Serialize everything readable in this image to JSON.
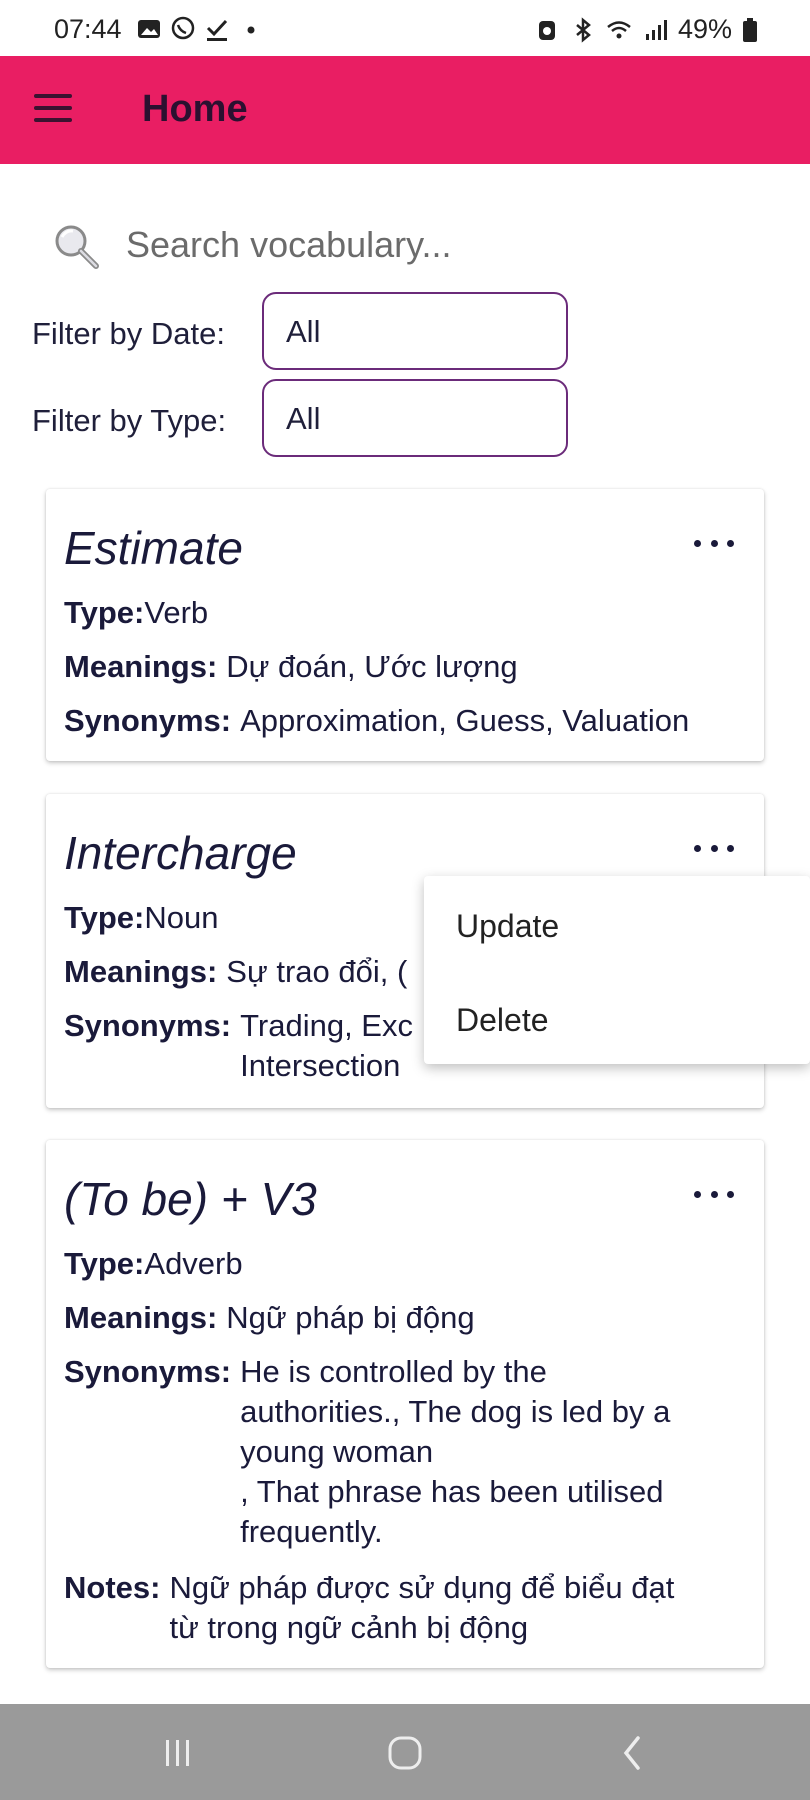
{
  "status_bar": {
    "time": "07:44",
    "battery": "49%"
  },
  "app_bar": {
    "title": "Home"
  },
  "search": {
    "placeholder": "Search vocabulary..."
  },
  "filters": {
    "date_label": "Filter by Date:",
    "date_value": "All",
    "type_label": "Filter by Type:",
    "type_value": "All"
  },
  "labels": {
    "type": "Type:",
    "meanings": "Meanings:",
    "synonyms": "Synonyms:",
    "notes": "Notes:"
  },
  "cards": [
    {
      "title": "Estimate",
      "type": "Verb",
      "meanings": "Dự đoán, Ước lượng",
      "synonyms": "Approximation, Guess, Valuation"
    },
    {
      "title": "Intercharge",
      "type": "Noun",
      "meanings": "Sự trao đổi, (",
      "synonyms": "Trading, Exc\nIntersection"
    },
    {
      "title": "(To be) + V3",
      "type": "Adverb",
      "meanings": "Ngữ pháp bị động",
      "synonyms": "He is controlled by the\nauthorities., The dog is led by a\nyoung woman\n, That phrase has been utilised\nfrequently.",
      "notes": "Ngữ pháp được sử dụng để biểu đạt\ntừ trong ngữ cảnh bị động"
    }
  ],
  "popup_menu": {
    "items": [
      "Update",
      "Delete"
    ]
  },
  "colors": {
    "accent": "#e91e63",
    "outline": "#6b2b7a",
    "text": "#1a1a3a",
    "nav_bar": "#9a9a9a"
  }
}
